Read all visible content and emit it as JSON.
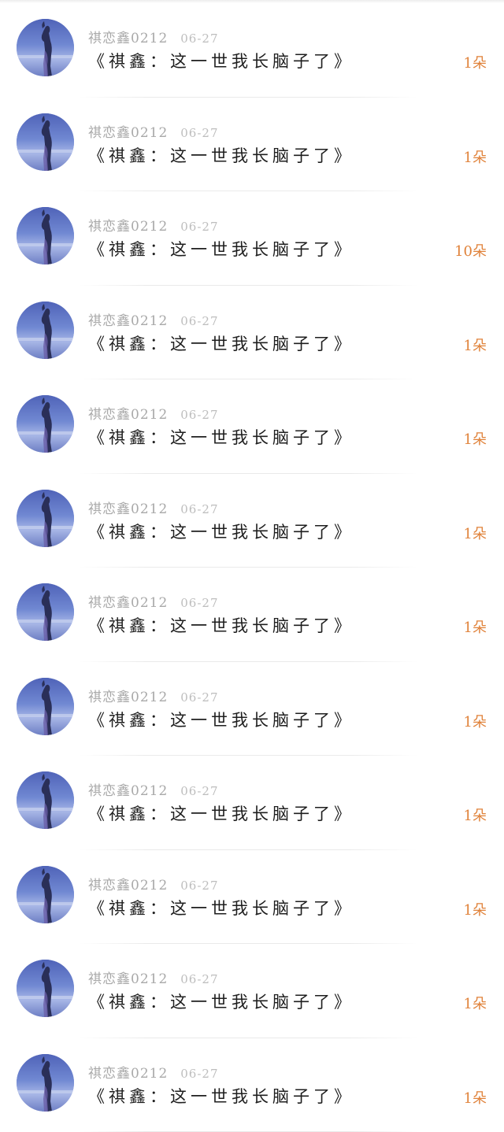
{
  "comments": [
    {
      "username": "祺恋鑫0212",
      "date": "06-27",
      "title": "《祺鑫：这一世我长脑子了》",
      "gift": "1朵"
    },
    {
      "username": "祺恋鑫0212",
      "date": "06-27",
      "title": "《祺鑫：这一世我长脑子了》",
      "gift": "1朵"
    },
    {
      "username": "祺恋鑫0212",
      "date": "06-27",
      "title": "《祺鑫：这一世我长脑子了》",
      "gift": "10朵"
    },
    {
      "username": "祺恋鑫0212",
      "date": "06-27",
      "title": "《祺鑫：这一世我长脑子了》",
      "gift": "1朵"
    },
    {
      "username": "祺恋鑫0212",
      "date": "06-27",
      "title": "《祺鑫：这一世我长脑子了》",
      "gift": "1朵"
    },
    {
      "username": "祺恋鑫0212",
      "date": "06-27",
      "title": "《祺鑫：这一世我长脑子了》",
      "gift": "1朵"
    },
    {
      "username": "祺恋鑫0212",
      "date": "06-27",
      "title": "《祺鑫：这一世我长脑子了》",
      "gift": "1朵"
    },
    {
      "username": "祺恋鑫0212",
      "date": "06-27",
      "title": "《祺鑫：这一世我长脑子了》",
      "gift": "1朵"
    },
    {
      "username": "祺恋鑫0212",
      "date": "06-27",
      "title": "《祺鑫：这一世我长脑子了》",
      "gift": "1朵"
    },
    {
      "username": "祺恋鑫0212",
      "date": "06-27",
      "title": "《祺鑫：这一世我长脑子了》",
      "gift": "1朵"
    },
    {
      "username": "祺恋鑫0212",
      "date": "06-27",
      "title": "《祺鑫：这一世我长脑子了》",
      "gift": "1朵"
    },
    {
      "username": "祺恋鑫0212",
      "date": "06-27",
      "title": "《祺鑫：这一世我长脑子了》",
      "gift": "1朵"
    }
  ],
  "colors": {
    "gift_accent": "#e0823a",
    "username": "#a9a9a9",
    "title": "#1e1e1e"
  },
  "icons": {
    "avatar": "avatar-photo"
  }
}
